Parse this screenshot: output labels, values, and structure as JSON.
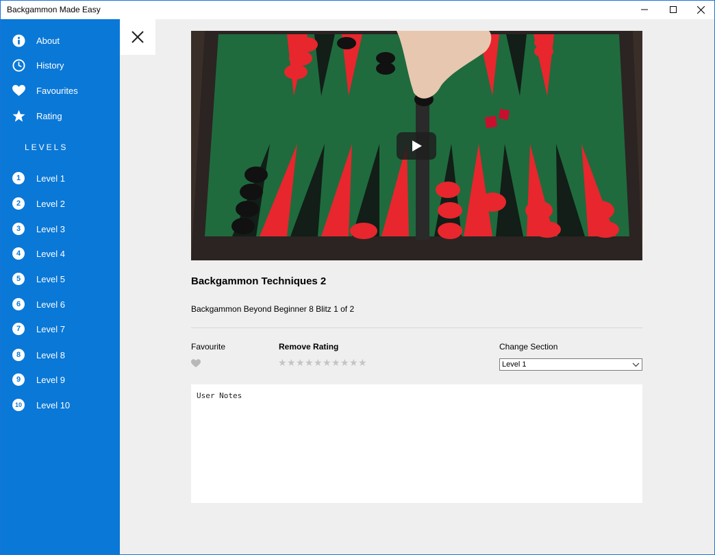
{
  "window": {
    "title": "Backgammon Made Easy"
  },
  "sidebar": {
    "menu": [
      {
        "label": "About",
        "icon": "info-icon"
      },
      {
        "label": "History",
        "icon": "clock-icon"
      },
      {
        "label": "Favourites",
        "icon": "heart-icon"
      },
      {
        "label": "Rating",
        "icon": "star-icon"
      }
    ],
    "levels_heading": "LEVELS",
    "levels": [
      {
        "num": "1",
        "label": "Level 1"
      },
      {
        "num": "2",
        "label": "Level 2"
      },
      {
        "num": "3",
        "label": "Level 3"
      },
      {
        "num": "4",
        "label": "Level 4"
      },
      {
        "num": "5",
        "label": "Level 5"
      },
      {
        "num": "6",
        "label": "Level 6"
      },
      {
        "num": "7",
        "label": "Level 7"
      },
      {
        "num": "8",
        "label": "Level 8"
      },
      {
        "num": "9",
        "label": "Level 9"
      },
      {
        "num": "10",
        "label": "Level 10"
      }
    ]
  },
  "video": {
    "title": "Backgammon Techniques 2",
    "description": "Backgammon Beyond Beginner 8 Blitz 1 of 2"
  },
  "controls": {
    "favourite_label": "Favourite",
    "rating_label": "Remove Rating",
    "rating_stars_total": 10,
    "rating_value": 0,
    "section_label": "Change Section",
    "section_selected": "Level 1"
  },
  "notes": {
    "placeholder": "User Notes"
  },
  "colors": {
    "accent": "#0a78d7",
    "background": "#efefef"
  }
}
